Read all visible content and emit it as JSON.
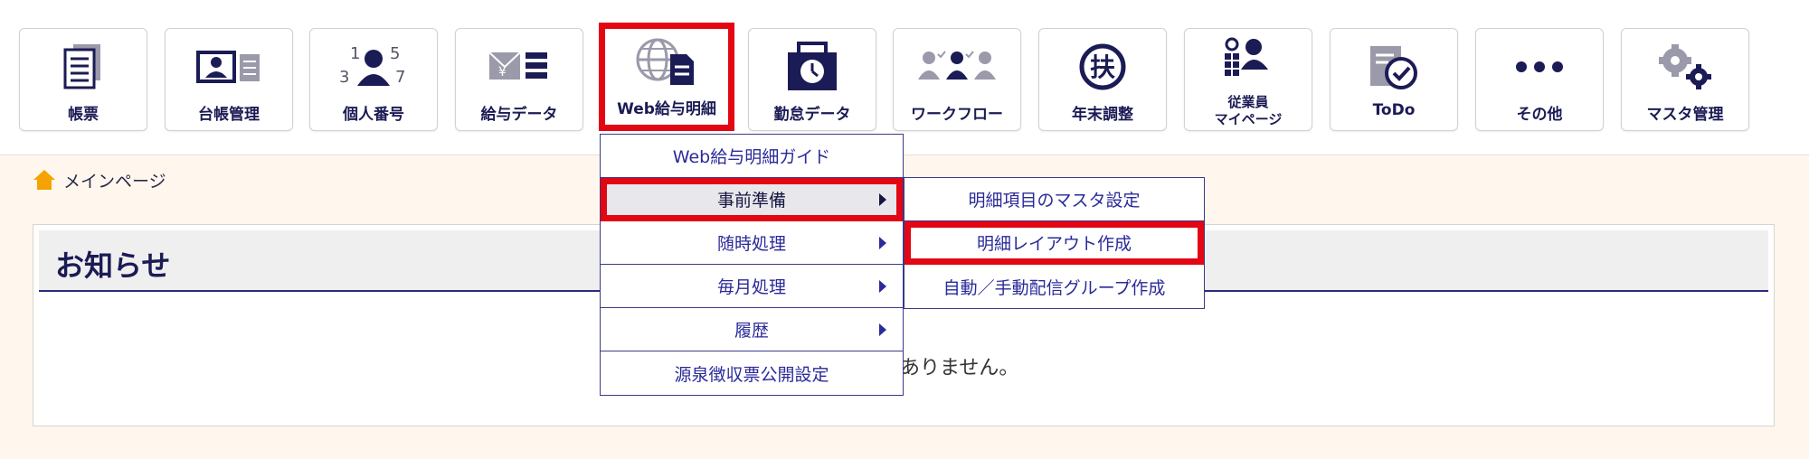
{
  "toolbar": {
    "buttons": [
      {
        "label": "帳票",
        "icon": "document-icon"
      },
      {
        "label": "台帳管理",
        "icon": "id-card-icon"
      },
      {
        "label": "個人番号",
        "icon": "person-number-icon"
      },
      {
        "label": "給与データ",
        "icon": "salary-data-icon"
      },
      {
        "label": "Web給与明細",
        "icon": "web-payslip-icon"
      },
      {
        "label": "勤怠データ",
        "icon": "attendance-icon"
      },
      {
        "label": "ワークフロー",
        "icon": "workflow-icon"
      },
      {
        "label": "年末調整",
        "icon": "year-end-adjustment-icon"
      },
      {
        "label_line1": "従業員",
        "label_line2": "マイページ",
        "icon": "employee-mypage-icon"
      },
      {
        "label": "ToDo",
        "icon": "todo-icon"
      },
      {
        "label": "その他",
        "icon": "more-icon"
      },
      {
        "label": "マスタ管理",
        "icon": "master-settings-icon"
      }
    ]
  },
  "breadcrumb": {
    "label": "メインページ",
    "icon": "home-icon"
  },
  "notice": {
    "title": "お知らせ",
    "message": "ありません。"
  },
  "menu": {
    "items": [
      "Web給与明細ガイド",
      "事前準備",
      "随時処理",
      "毎月処理",
      "履歴",
      "源泉徴収票公開設定"
    ],
    "submenu": [
      "明細項目のマスタ設定",
      "明細レイアウト作成",
      "自動／手動配信グループ作成"
    ]
  },
  "colors": {
    "accent": "#1b1b55",
    "highlight": "#e30613",
    "background": "#fff7ee",
    "icon_gray": "#9a9aaa"
  }
}
